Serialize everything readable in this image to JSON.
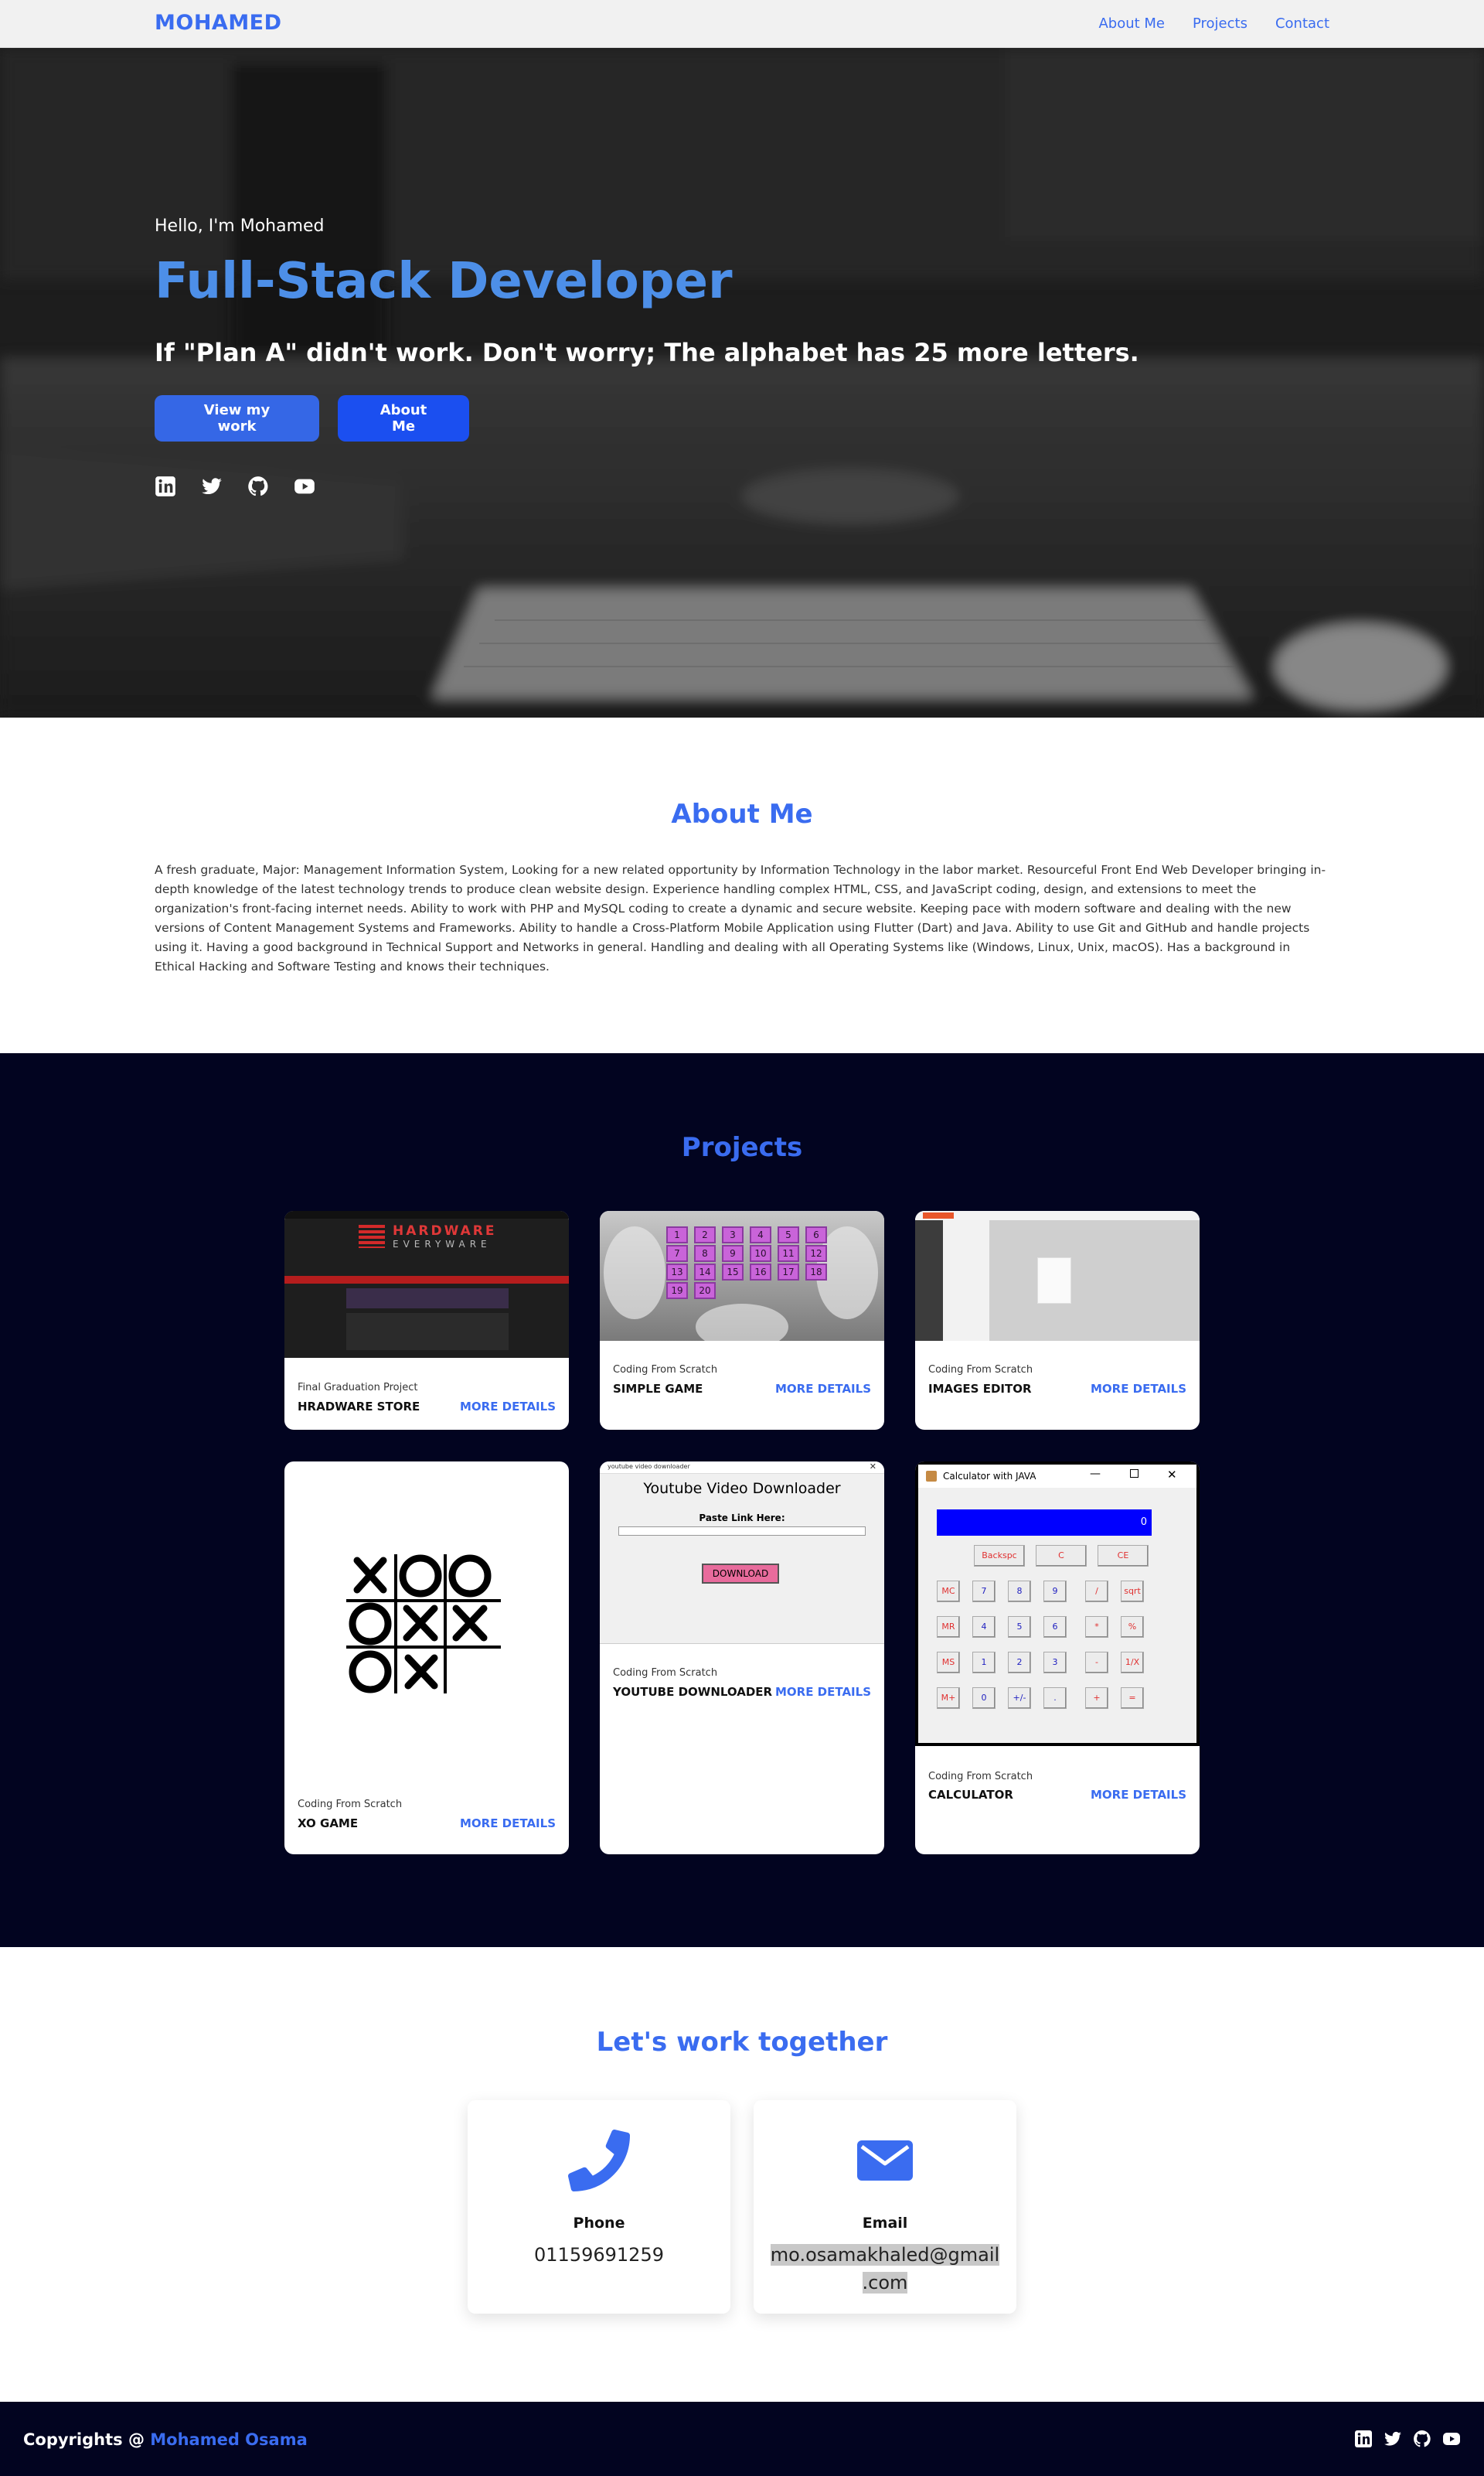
{
  "nav": {
    "brand": "MOHAMED",
    "links": [
      "About Me",
      "Projects",
      "Contact"
    ]
  },
  "hero": {
    "greeting": "Hello, I'm Mohamed",
    "title": "Full-Stack Developer",
    "quote": "If \"Plan A\" didn't work. Don't worry; The alphabet has 25 more letters.",
    "buttons": {
      "primary": "View my work",
      "secondary": "About Me"
    },
    "social_icons": [
      "linkedin-icon",
      "twitter-icon",
      "github-icon",
      "youtube-icon"
    ]
  },
  "about": {
    "title": "About Me",
    "text": "A fresh graduate, Major: Management Information System, Looking for a new related opportunity by Information Technology in the labor market. Resourceful Front End Web Developer bringing in-depth knowledge of the latest technology trends to produce clean website design. Experience handling complex HTML, CSS, and JavaScript coding, design, and extensions to meet the organization's front-facing internet needs. Ability to work with PHP and MySQL coding to create a dynamic and secure website. Keeping pace with modern software and dealing with the new versions of Content Management Systems and Frameworks. Ability to handle a Cross-Platform Mobile Application using Flutter (Dart) and Java. Ability to use Git and GitHub and handle projects using it. Having a good background in Technical Support and Networks in general. Handling and dealing with all Operating Systems like (Windows, Linux, Unix, macOS). Has a background in Ethical Hacking and Software Testing and knows their techniques."
  },
  "projects": {
    "title": "Projects",
    "more_label": "MORE DETAILS",
    "items": [
      {
        "subtitle": "Final Graduation Project",
        "name": "HRADWARE STORE",
        "thumb_title": "HARDWARE",
        "thumb_sub": "EVERYWARE"
      },
      {
        "subtitle": "Coding From Scratch",
        "name": "SIMPLE GAME",
        "tiles": [
          "1",
          "2",
          "3",
          "4",
          "5",
          "6",
          "7",
          "8",
          "9",
          "10",
          "11",
          "12",
          "13",
          "14",
          "15",
          "16",
          "17",
          "18",
          "19",
          "20"
        ]
      },
      {
        "subtitle": "Coding From Scratch",
        "name": "IMAGES EDITOR"
      },
      {
        "subtitle": "Coding From Scratch",
        "name": "XO GAME"
      },
      {
        "subtitle": "Coding From Scratch",
        "name": "YOUTUBE DOWNLOADER",
        "window_title": "youtube video downloader",
        "heading": "Youtube Video Downloader",
        "field_label": "Paste Link Here:",
        "button": "DOWNLOAD"
      },
      {
        "subtitle": "Coding From Scratch",
        "name": "CALCULATOR",
        "window_title": "Calculator with JAVA",
        "display": "0",
        "keys": [
          [
            "Backspc",
            "C",
            "CE"
          ],
          [
            "MC",
            "7",
            "8",
            "9",
            "/",
            "sqrt"
          ],
          [
            "MR",
            "4",
            "5",
            "6",
            "*",
            "%"
          ],
          [
            "MS",
            "1",
            "2",
            "3",
            "-",
            "1/X"
          ],
          [
            "M+",
            "0",
            "+/-",
            ".",
            "+",
            "="
          ]
        ]
      }
    ]
  },
  "contact": {
    "title": "Let's work together",
    "phone": {
      "label": "Phone",
      "value": "01159691259"
    },
    "email": {
      "label": "Email",
      "value_line1": "mo.osamakhaled@gmail",
      "value_line2": ".com"
    }
  },
  "footer": {
    "prefix": "Copyrights @ ",
    "name": "Mohamed Osama"
  },
  "colors": {
    "accent": "#3a6cf0",
    "hero_title": "#4d8fe8",
    "dark_bg": "#020420"
  }
}
